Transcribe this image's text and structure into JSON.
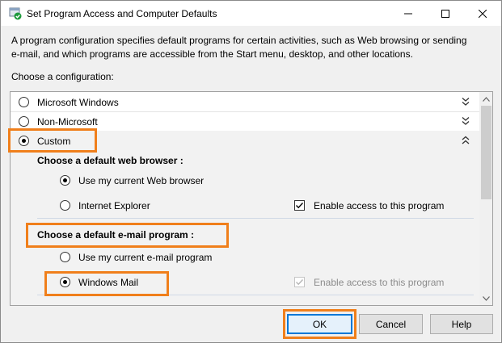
{
  "window": {
    "title": "Set Program Access and Computer Defaults",
    "icon": "shield-check-icon"
  },
  "description": "A program configuration specifies default programs for certain activities, such as Web browsing or sending e-mail, and which programs are accessible from the Start menu, desktop, and other locations.",
  "description_line1": "A program configuration specifies default programs for certain activities, such as Web browsing or sending",
  "description_line2": "e-mail, and which programs are accessible from the Start menu, desktop, and other locations.",
  "choose_label": "Choose a configuration:",
  "configurations": [
    {
      "label": "Microsoft Windows",
      "selected": false,
      "expanded": false
    },
    {
      "label": "Non-Microsoft",
      "selected": false,
      "expanded": false
    },
    {
      "label": "Custom",
      "selected": true,
      "expanded": true
    }
  ],
  "custom": {
    "browser_section": {
      "heading": "Choose a default web browser :",
      "options": [
        {
          "label": "Use my current Web browser",
          "selected": true
        },
        {
          "label": "Internet Explorer",
          "selected": false
        }
      ],
      "enable_access_label": "Enable access to this program",
      "enable_access_checked": true,
      "enable_access_enabled": true
    },
    "email_section": {
      "heading": "Choose a default e-mail program :",
      "options": [
        {
          "label": "Use my current e-mail program",
          "selected": false
        },
        {
          "label": "Windows Mail",
          "selected": true
        }
      ],
      "enable_access_label": "Enable access to this program",
      "enable_access_checked": true,
      "enable_access_enabled": false
    }
  },
  "buttons": {
    "ok": "OK",
    "cancel": "Cancel",
    "help": "Help"
  },
  "colors": {
    "highlight": "#f07f1b",
    "default_button_border": "#0078d7"
  }
}
